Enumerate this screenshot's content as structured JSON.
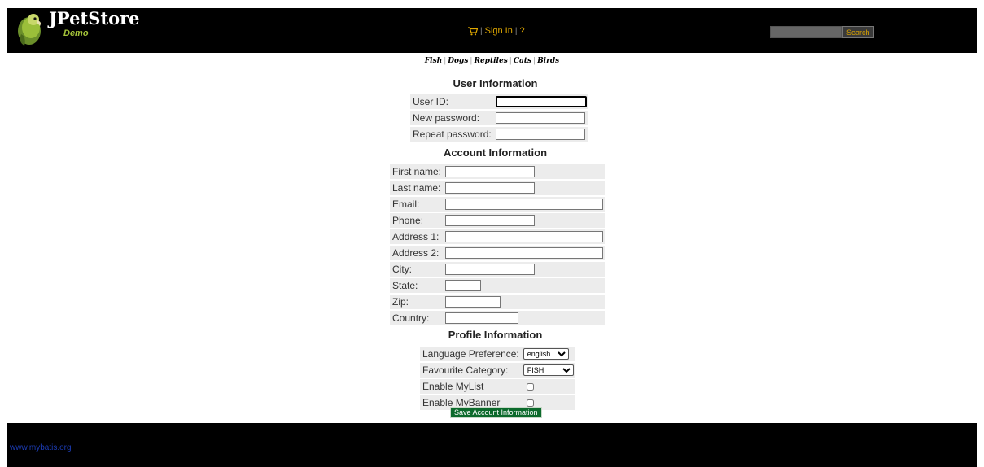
{
  "header": {
    "logo_title": "JPetStore",
    "logo_subtitle": "Demo",
    "menu": {
      "sign_in": "Sign In",
      "help": "?"
    },
    "search": {
      "placeholder": "",
      "button": "Search"
    }
  },
  "quicklinks": [
    "Fish",
    "Dogs",
    "Reptiles",
    "Cats",
    "Birds"
  ],
  "user_information": {
    "title": "User Information",
    "fields": [
      {
        "label": "User ID:",
        "value": ""
      },
      {
        "label": "New password:",
        "value": ""
      },
      {
        "label": "Repeat password:",
        "value": ""
      }
    ]
  },
  "account_information": {
    "title": "Account Information",
    "fields": [
      {
        "label": "First name:",
        "value": ""
      },
      {
        "label": "Last name:",
        "value": ""
      },
      {
        "label": "Email:",
        "value": ""
      },
      {
        "label": "Phone:",
        "value": ""
      },
      {
        "label": "Address 1:",
        "value": ""
      },
      {
        "label": "Address 2:",
        "value": ""
      },
      {
        "label": "City:",
        "value": ""
      },
      {
        "label": "State:",
        "value": ""
      },
      {
        "label": "Zip:",
        "value": ""
      },
      {
        "label": "Country:",
        "value": ""
      }
    ]
  },
  "profile_information": {
    "title": "Profile Information",
    "language_label": "Language Preference:",
    "language_value": "english",
    "category_label": "Favourite Category:",
    "category_value": "FISH",
    "mylist_label": "Enable MyList",
    "mybanner_label": "Enable MyBanner"
  },
  "save_button": "Save Account Information",
  "footer": {
    "link": "www.mybatis.org"
  },
  "colors": {
    "header_bg": "#000000",
    "menu_text": "#e0a800",
    "button_green": "#0c6a2c",
    "row_bg": "#ececec",
    "footer_link": "#1c3cb5"
  }
}
